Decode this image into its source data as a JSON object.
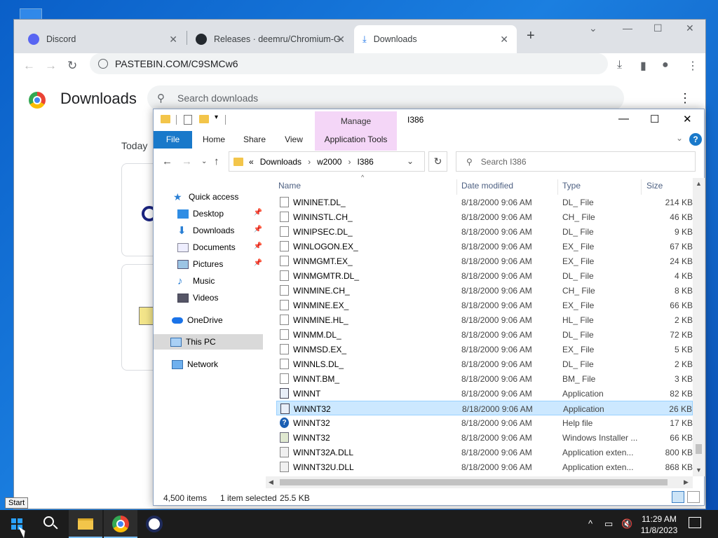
{
  "colors": {
    "accent": "#1979ca",
    "manage": "#f4d6f7",
    "selection": "#cce8ff",
    "taskbar": "#1c1c1c"
  },
  "chrome": {
    "tabs": [
      {
        "label": "Discord",
        "icon": "discord-icon"
      },
      {
        "label": "Releases · deemru/Chromium-G",
        "icon": "github-icon"
      },
      {
        "label": "Downloads",
        "icon": "download-icon"
      }
    ],
    "url": "PASTEBIN.COM/C9SMCw6",
    "page_title": "Downloads",
    "search_placeholder": "Search downloads",
    "section_today": "Today"
  },
  "explorer": {
    "context_tab": "Manage",
    "title": "I386",
    "ribbon": {
      "file": "File",
      "home": "Home",
      "share": "Share",
      "view": "View",
      "app_tools": "Application Tools"
    },
    "address": {
      "prefix": "«",
      "parts": [
        "Downloads",
        "w2000",
        "I386"
      ]
    },
    "search_placeholder": "Search I386",
    "nav": {
      "quick_access": "Quick access",
      "desktop": "Desktop",
      "downloads": "Downloads",
      "documents": "Documents",
      "pictures": "Pictures",
      "music": "Music",
      "videos": "Videos",
      "onedrive": "OneDrive",
      "this_pc": "This PC",
      "network": "Network"
    },
    "columns": {
      "name": "Name",
      "date": "Date modified",
      "type": "Type",
      "size": "Size"
    },
    "files": [
      {
        "name": "WININET.DL_",
        "date": "8/18/2000 9:06 AM",
        "type": "DL_ File",
        "size": "214 KB",
        "icon": "file-icon"
      },
      {
        "name": "WININSTL.CH_",
        "date": "8/18/2000 9:06 AM",
        "type": "CH_ File",
        "size": "46 KB",
        "icon": "file-icon"
      },
      {
        "name": "WINIPSEC.DL_",
        "date": "8/18/2000 9:06 AM",
        "type": "DL_ File",
        "size": "9 KB",
        "icon": "file-icon"
      },
      {
        "name": "WINLOGON.EX_",
        "date": "8/18/2000 9:06 AM",
        "type": "EX_ File",
        "size": "67 KB",
        "icon": "file-icon"
      },
      {
        "name": "WINMGMT.EX_",
        "date": "8/18/2000 9:06 AM",
        "type": "EX_ File",
        "size": "24 KB",
        "icon": "file-icon"
      },
      {
        "name": "WINMGMTR.DL_",
        "date": "8/18/2000 9:06 AM",
        "type": "DL_ File",
        "size": "4 KB",
        "icon": "file-icon"
      },
      {
        "name": "WINMINE.CH_",
        "date": "8/18/2000 9:06 AM",
        "type": "CH_ File",
        "size": "8 KB",
        "icon": "file-icon"
      },
      {
        "name": "WINMINE.EX_",
        "date": "8/18/2000 9:06 AM",
        "type": "EX_ File",
        "size": "66 KB",
        "icon": "file-icon"
      },
      {
        "name": "WINMINE.HL_",
        "date": "8/18/2000 9:06 AM",
        "type": "HL_ File",
        "size": "2 KB",
        "icon": "file-icon"
      },
      {
        "name": "WINMM.DL_",
        "date": "8/18/2000 9:06 AM",
        "type": "DL_ File",
        "size": "72 KB",
        "icon": "file-icon"
      },
      {
        "name": "WINMSD.EX_",
        "date": "8/18/2000 9:06 AM",
        "type": "EX_ File",
        "size": "5 KB",
        "icon": "file-icon"
      },
      {
        "name": "WINNLS.DL_",
        "date": "8/18/2000 9:06 AM",
        "type": "DL_ File",
        "size": "2 KB",
        "icon": "file-icon"
      },
      {
        "name": "WINNT.BM_",
        "date": "8/18/2000 9:06 AM",
        "type": "BM_ File",
        "size": "3 KB",
        "icon": "file-icon"
      },
      {
        "name": "WINNT",
        "date": "8/18/2000 9:06 AM",
        "type": "Application",
        "size": "82 KB",
        "icon": "app-icon"
      },
      {
        "name": "WINNT32",
        "date": "8/18/2000 9:06 AM",
        "type": "Application",
        "size": "26 KB",
        "icon": "app-icon",
        "selected": true
      },
      {
        "name": "WINNT32",
        "date": "8/18/2000 9:06 AM",
        "type": "Help file",
        "size": "17 KB",
        "icon": "help-icon"
      },
      {
        "name": "WINNT32",
        "date": "8/18/2000 9:06 AM",
        "type": "Windows Installer ...",
        "size": "66 KB",
        "icon": "installer-icon"
      },
      {
        "name": "WINNT32A.DLL",
        "date": "8/18/2000 9:06 AM",
        "type": "Application exten...",
        "size": "800 KB",
        "icon": "dll-icon"
      },
      {
        "name": "WINNT32U.DLL",
        "date": "8/18/2000 9:06 AM",
        "type": "Application exten...",
        "size": "868 KB",
        "icon": "dll-icon"
      }
    ],
    "status": {
      "count": "4,500 items",
      "selected": "1 item selected",
      "size": "25.5 KB"
    }
  },
  "taskbar": {
    "tooltip": "Start",
    "time": "11:29 AM",
    "date": "11/8/2023"
  }
}
